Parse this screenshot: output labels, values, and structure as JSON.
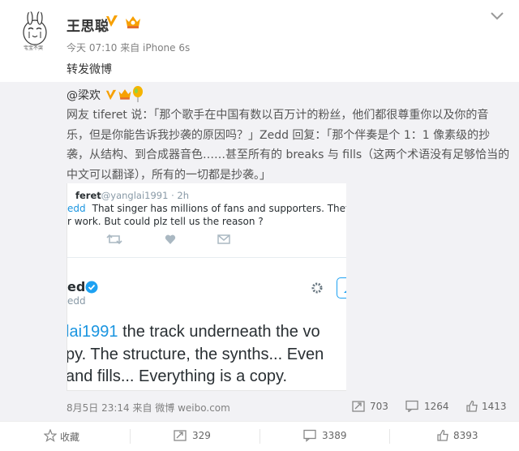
{
  "header": {
    "username": "王思聪",
    "meta": "今天 07:10 来自 iPhone 6s",
    "post_text": "转发微博",
    "avatar_caption": "宝宝不哭"
  },
  "original": {
    "username": "@梁欢",
    "text": "网友 tiferet 说：「那个歌手在中国有数以百万计的粉丝，他们都很尊重你以及你的音乐，但是你能告诉我抄袭的原因吗？」Zedd 回复：「那个伴奏是个 1：1 像素级的抄袭，从结构、到合成器音色……甚至所有的 breaks 与 fills（这两个术语没有足够恰当的中文可以翻译），所有的一切都是抄袭。」",
    "meta": "8月5日 23:14 来自 微博 weibo.com",
    "reposts": "703",
    "comments": "1264",
    "likes": "1413"
  },
  "tweet1": {
    "handle_name": "feret",
    "handle_rest": "@yanglai1991 · 2h",
    "mention": "edd",
    "line1": "That singer has millions of fans and supporters. They respec",
    "line2": "r work. But could plz tell us the reason ?"
  },
  "tweet2": {
    "name": "edd",
    "handle": "edd",
    "mention": "lai1991",
    "line1_rest": " the track underneath the vo",
    "line2": "py. The structure, the synths... Even",
    "line3": " and fills... Everything is a copy."
  },
  "bottombar": {
    "favorite_label": "收藏",
    "reposts": "329",
    "comments": "3389",
    "likes": "8393"
  },
  "colors": {
    "accent_orange": "#f7a000",
    "twitter_blue": "#1da1f2",
    "repost_bg": "#f2f2f5"
  }
}
